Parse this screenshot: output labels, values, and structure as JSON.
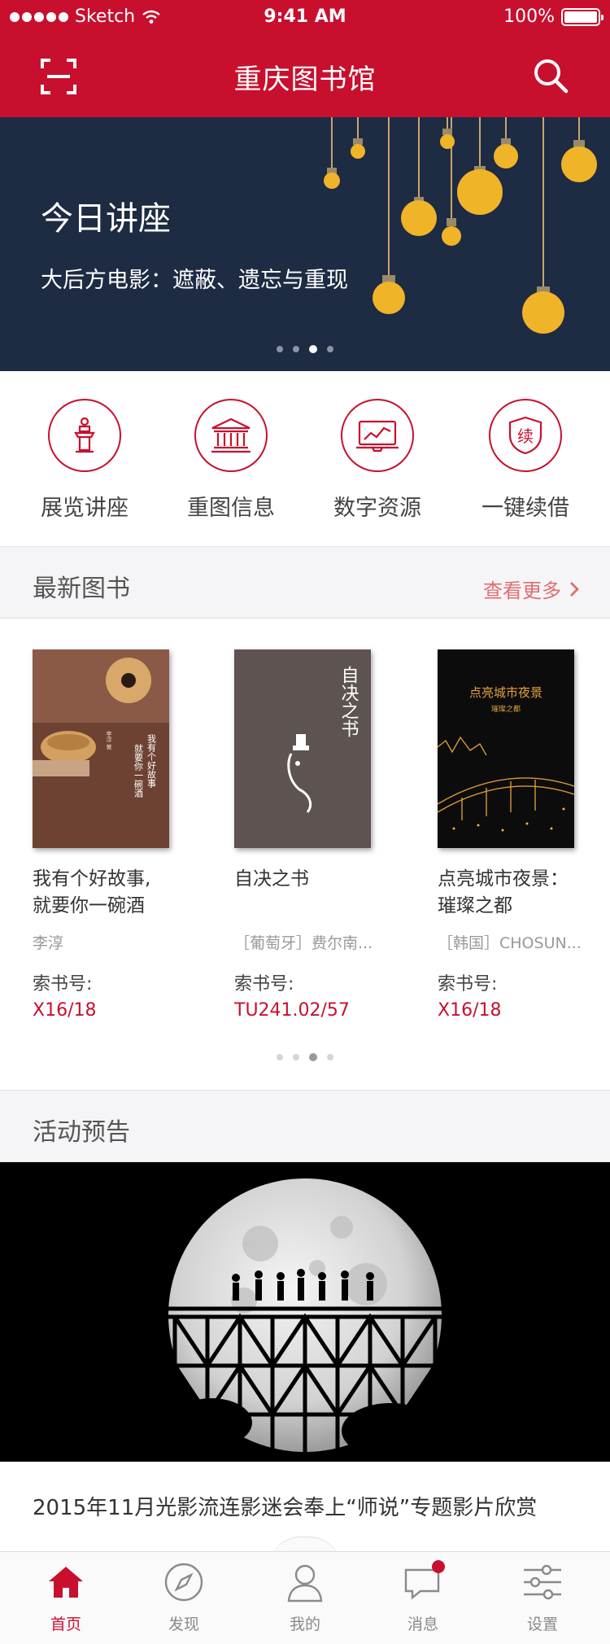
{
  "status_bar": {
    "carrier": "Sketch",
    "time": "9:41 AM",
    "battery": "100%"
  },
  "header": {
    "title": "重庆图书馆",
    "scan_icon": "scan-icon",
    "search_icon": "search-icon"
  },
  "banner": {
    "heading": "今日讲座",
    "subtitle": "大后方电影：遮蔽、遗忘与重现",
    "page_count": 4,
    "active_page": 3
  },
  "quick_entries": [
    {
      "label": "展览讲座",
      "icon": "podium-icon"
    },
    {
      "label": "重图信息",
      "icon": "library-building-icon"
    },
    {
      "label": "数字资源",
      "icon": "digital-monitor-icon"
    },
    {
      "label": "一键续借",
      "icon": "renew-shield-icon",
      "icon_text": "续"
    }
  ],
  "new_books": {
    "section_title": "最新图书",
    "more_label": "查看更多",
    "call_number_label": "索书号:",
    "items": [
      {
        "title": "我有个好故事,就要你一碗酒",
        "author": "李淳",
        "call_number": "X16/18",
        "cover_author": "李淳 著",
        "cover_title": "我有个好故事 就要你一碗酒"
      },
      {
        "title": "自决之书",
        "author": "［葡萄牙］费尔南...",
        "call_number": "TU241.02/57",
        "cover_title": "自决之书"
      },
      {
        "title": "点亮城市夜景：璀璨之都",
        "author": "［韩国］CHOSUN...",
        "call_number": "X16/18",
        "cover_title": "点亮城市夜景",
        "cover_subtitle": "璀璨之都"
      }
    ],
    "page_count": 4,
    "active_page": 3
  },
  "activities": {
    "section_title": "活动预告",
    "title": "2015年11月光影流连影迷会奉上“师说”专题影片欣赏"
  },
  "tab_bar": {
    "tabs": [
      {
        "label": "首页",
        "icon": "home-icon",
        "active": true
      },
      {
        "label": "发现",
        "icon": "compass-icon",
        "active": false
      },
      {
        "label": "我的",
        "icon": "user-icon",
        "active": false
      },
      {
        "label": "消息",
        "icon": "message-icon",
        "active": false,
        "badge": true
      },
      {
        "label": "设置",
        "icon": "settings-sliders-icon",
        "active": false
      }
    ]
  },
  "colors": {
    "brand": "#c8102e",
    "link": "#e26d6d",
    "banner_bg": "#1d2b43",
    "bulb": "#f0b429"
  }
}
